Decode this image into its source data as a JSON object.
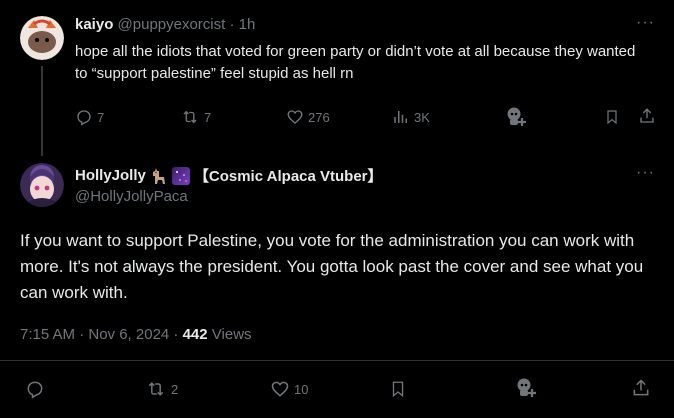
{
  "reply_parent": {
    "display_name": "kaiyo",
    "handle": "@puppyexorcist",
    "separator": "·",
    "time": "1h",
    "text": "hope all the idiots that voted for green party or didn’t vote at all because they wanted to “support palestine” feel stupid as hell rn",
    "stats": {
      "replies": "7",
      "reposts": "7",
      "likes": "276",
      "views": "3K"
    }
  },
  "main_post": {
    "display_name": "HollyJolly",
    "display_suffix": "【Cosmic Alpaca Vtuber】",
    "handle": "@HollyJollyPaca",
    "text": "If you want to support Palestine, you vote for the administration you can work with more. It's not always the president. You gotta look past the cover and see what you can work with.",
    "time": "7:15 AM · Nov 6, 2024 · ",
    "views_count": "442",
    "views_label": " Views",
    "stats": {
      "reposts": "2",
      "likes": "10"
    }
  },
  "icons": [
    "reply-icon",
    "repost-icon",
    "like-icon",
    "views-icon",
    "grok-icon",
    "bookmark-icon",
    "share-icon",
    "more-icon",
    "llama-emoji",
    "galaxy-emoji"
  ],
  "colors": {
    "background": "#000000",
    "text": "#e7e9ea",
    "muted": "#71767b",
    "divider": "#2f3336"
  }
}
